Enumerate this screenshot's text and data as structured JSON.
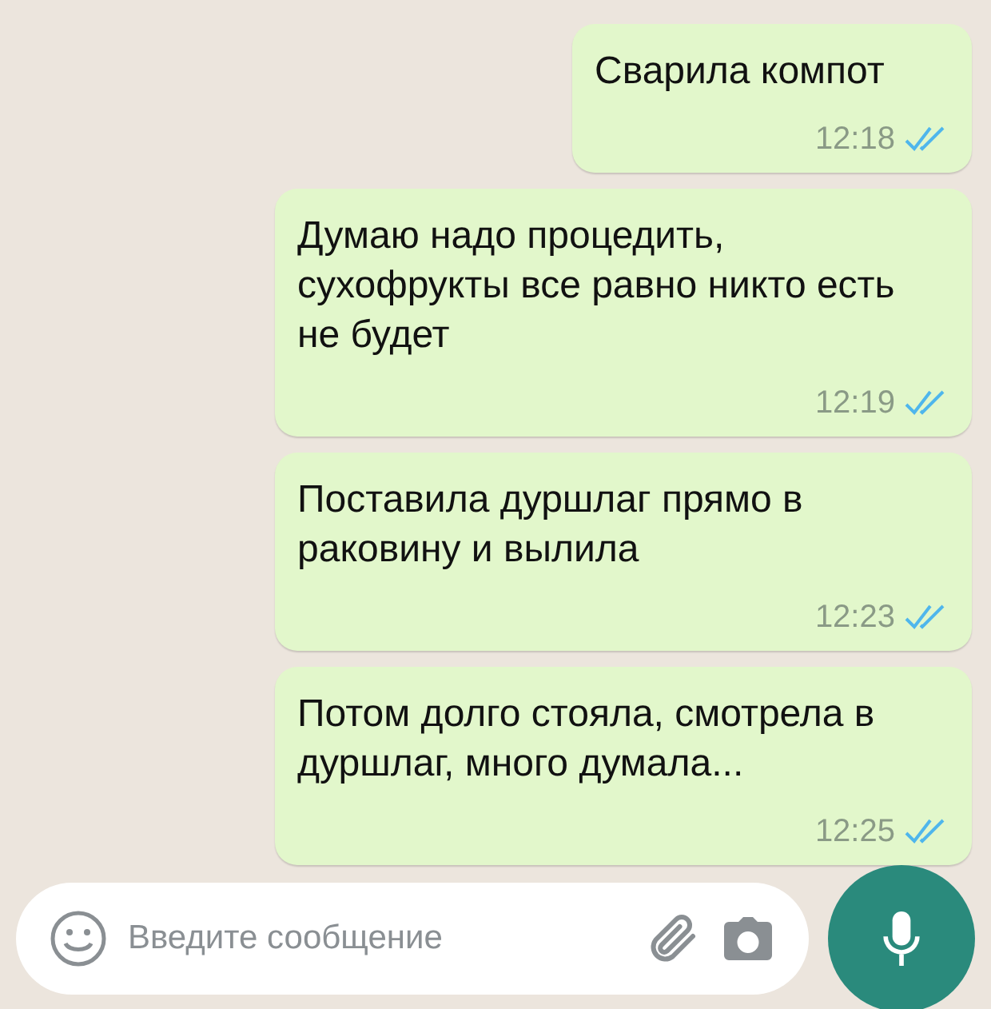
{
  "messages": [
    {
      "text": "Сварила компот",
      "time": "12:18",
      "read": true
    },
    {
      "text": "Думаю надо процедить, сухофрукты все равно никто есть не будет",
      "time": "12:19",
      "read": true
    },
    {
      "text": "Поставила дуршлаг прямо в раковину и вылила",
      "time": "12:23",
      "read": true
    },
    {
      "text": "Потом долго стояла, смотрела в дуршлаг, много думала...",
      "time": "12:25",
      "read": true
    }
  ],
  "composer": {
    "placeholder": "Введите сообщение"
  }
}
